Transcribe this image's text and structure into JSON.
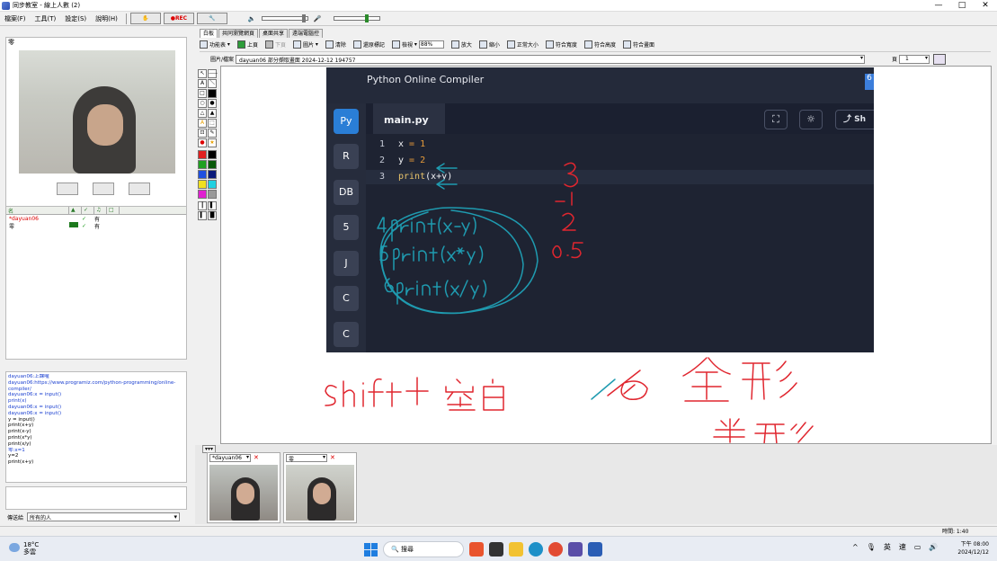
{
  "window": {
    "title": "同步教室 - 線上人數 (2)",
    "controls": [
      "—",
      "□",
      "✕"
    ]
  },
  "menu": {
    "items": [
      "檔案(F)",
      "工具(T)",
      "設定(S)",
      "說明(H)"
    ],
    "rec_label": "●REC"
  },
  "left": {
    "cam_label": "零",
    "user_list": {
      "headers": [
        "名",
        "",
        "",
        "",
        ""
      ],
      "rows": [
        {
          "name": "*dayuan06",
          "status": "✓",
          "flag": "有",
          "self": true
        },
        {
          "name": "零",
          "status": "✓",
          "flag": "有",
          "self": false
        }
      ]
    },
    "chat": [
      {
        "text": "dayuan06:上課囉",
        "blue": true
      },
      {
        "text": "dayuan06:https://www.programiz.com/python-programming/online-",
        "blue": true
      },
      {
        "text": "compiler/",
        "blue": true
      },
      {
        "text": "dayuan06:x = input()",
        "blue": true
      },
      {
        "text": "print(x)",
        "blue": true
      },
      {
        "text": "dayuan06:x = input()",
        "blue": true
      },
      {
        "text": "dayuan06:x = input()",
        "blue": true
      },
      {
        "text": "y = input()",
        "blue": false
      },
      {
        "text": "print(x+y)",
        "blue": false
      },
      {
        "text": "print(x-y)",
        "blue": false
      },
      {
        "text": "print(x*y)",
        "blue": false
      },
      {
        "text": "print(x/y)",
        "blue": false
      },
      {
        "text": "零:x=1",
        "blue": true
      },
      {
        "text": "y=2",
        "blue": false
      },
      {
        "text": "print(x+y)",
        "blue": false
      }
    ],
    "send_label": "傳送給",
    "send_target": "所有的人"
  },
  "tabs": [
    "白板",
    "共同瀏覽網頁",
    "桌面共享",
    "遠端電腦控"
  ],
  "toolbar": {
    "items": [
      "功能表",
      "上頁",
      "下頁",
      "圖片",
      "清除",
      "還原標記",
      "檢視",
      "放大",
      "縮小",
      "正常大小",
      "符合寬度",
      "符合高度",
      "符合畫面"
    ],
    "zoom": "88%"
  },
  "path": {
    "label": "圖片/檔案",
    "value": "dayuan06 部分擷取畫面 2024-12-12 194757",
    "page_label": "頁",
    "page_value": "1"
  },
  "screenshot": {
    "title": "Python Online Compiler",
    "badge": "6",
    "file_tab": "main.py",
    "share": "Sh",
    "languages": [
      "Py",
      "R",
      "DB",
      "5",
      "J",
      "C",
      "C"
    ],
    "code": [
      {
        "ln": "1",
        "parts": [
          [
            "x ",
            ""
          ],
          [
            "= ",
            "op"
          ],
          [
            "1",
            "op"
          ]
        ]
      },
      {
        "ln": "2",
        "parts": [
          [
            "y ",
            ""
          ],
          [
            "= ",
            "op"
          ],
          [
            "2",
            "op"
          ]
        ]
      },
      {
        "ln": "3",
        "parts": [
          [
            "print",
            "fn"
          ],
          [
            "(x+y)",
            ""
          ]
        ]
      }
    ]
  },
  "ink_colors": {
    "teal": "#1f9bb0",
    "red": "#e0262f"
  },
  "bottom": {
    "collapse": "▾▾▾",
    "thumbs": [
      {
        "name": "*dayuan06"
      },
      {
        "name": "零"
      }
    ]
  },
  "status": {
    "time": "時間: 1:40"
  },
  "taskbar": {
    "temp": "18°C",
    "weather": "多雲",
    "search": "搜尋",
    "tray": [
      "^",
      "英",
      "𝄞"
    ],
    "time": "下午 08:00",
    "date": "2024/12/12"
  }
}
